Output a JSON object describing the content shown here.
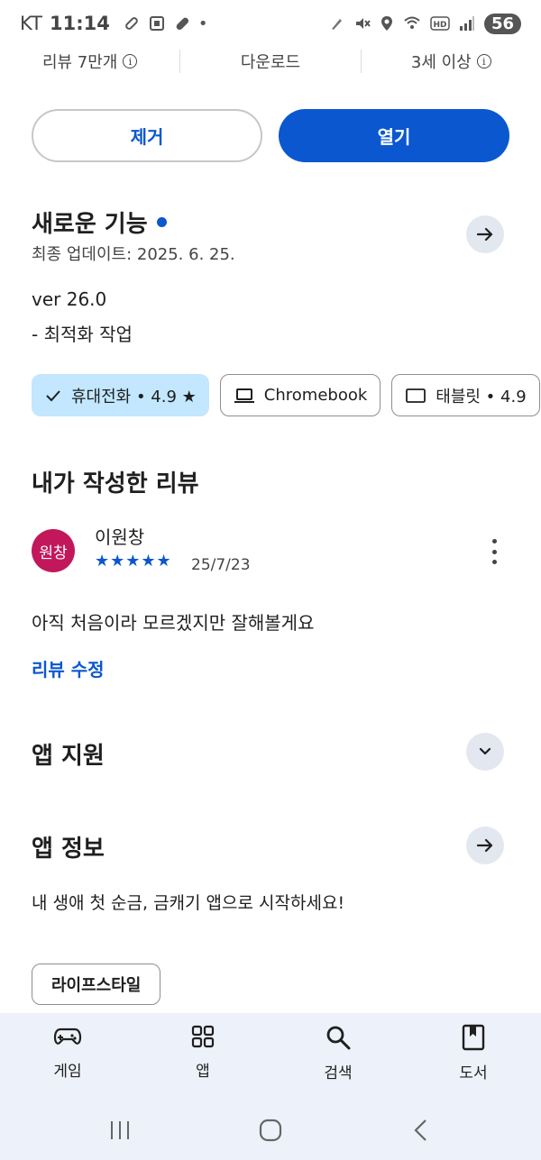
{
  "status_bar": {
    "carrier": "KT",
    "time": "11:14",
    "battery": "56"
  },
  "stats": {
    "reviews": "리뷰 7만개",
    "downloads": "다운로드",
    "age": "3세 이상"
  },
  "actions": {
    "remove_label": "제거",
    "open_label": "열기"
  },
  "whats_new": {
    "title": "새로운 기능",
    "updated": "최종 업데이트: 2025. 6. 25.",
    "version": "ver 26.0",
    "note": "- 최적화 작업"
  },
  "device_chips": [
    {
      "label": "휴대전화 • 4.9 ★",
      "icon": "check-icon",
      "selected": true
    },
    {
      "label": "Chromebook",
      "icon": "laptop-icon",
      "selected": false
    },
    {
      "label": "태블릿 • 4.9",
      "icon": "tablet-icon",
      "selected": false
    }
  ],
  "my_review": {
    "title": "내가 작성한 리뷰",
    "avatar_text": "원창",
    "reviewer": "이원창",
    "stars": "★★★★★",
    "date": "25/7/23",
    "text": "아직 처음이라 모르겠지만 잘해볼게요",
    "edit_label": "리뷰 수정"
  },
  "app_support": {
    "title": "앱 지원"
  },
  "app_info": {
    "title": "앱 정보",
    "description": "내 생애 첫 순금, 금캐기 앱으로 시작하세요!",
    "tag": "라이프스타일"
  },
  "bottom_nav": [
    {
      "label": "게임",
      "icon": "gamepad-icon"
    },
    {
      "label": "앱",
      "icon": "apps-grid-icon"
    },
    {
      "label": "검색",
      "icon": "search-icon"
    },
    {
      "label": "도서",
      "icon": "book-icon"
    }
  ],
  "colors": {
    "accent": "#0b57d0",
    "chip_selected": "#c2e7ff",
    "avatar": "#c2185b",
    "nav_background": "#edf1f9"
  }
}
